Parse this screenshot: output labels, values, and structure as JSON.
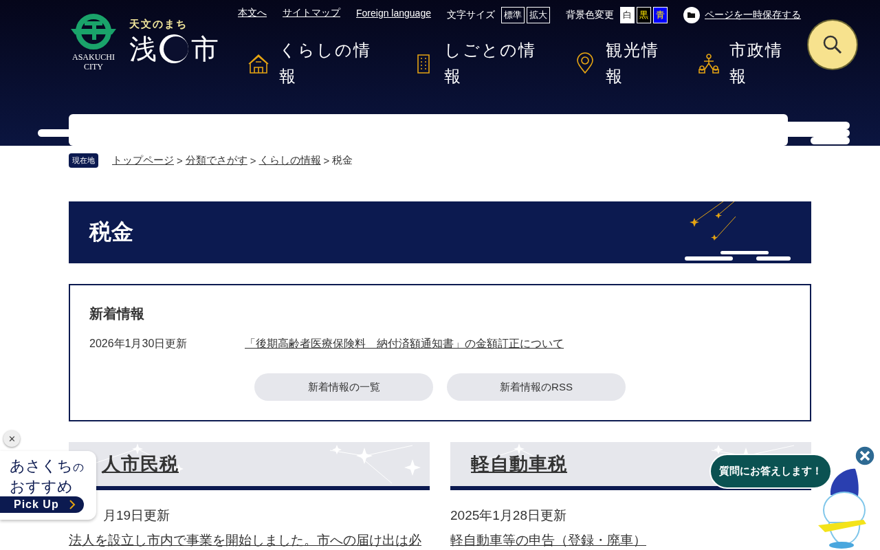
{
  "header": {
    "emblem_text": [
      "ASAKUCHI",
      "CITY"
    ],
    "tagline": "天文のまち",
    "logo_left": "浅",
    "logo_right": "市",
    "utility_links": [
      "本文へ",
      "サイトマップ",
      "Foreign language"
    ],
    "font_size": {
      "label": "文字サイズ",
      "options": [
        "標準",
        "拡大"
      ]
    },
    "bg_color": {
      "label": "背景色変更",
      "options": [
        {
          "label": "白",
          "color": "#ffffff"
        },
        {
          "label": "黒",
          "color": "#000000"
        },
        {
          "label": "青",
          "color": "#0000ff"
        }
      ]
    },
    "save_page": "ページを一時保存する",
    "nav": [
      {
        "label": "くらしの情報",
        "kind": "house"
      },
      {
        "label": "しごとの情報",
        "kind": "building"
      },
      {
        "label": "観光情報",
        "kind": "pin"
      },
      {
        "label": "市政情報",
        "kind": "people"
      }
    ]
  },
  "breadcrumb": {
    "badge": "現在地",
    "separator": ">",
    "items": [
      {
        "label": "トップページ",
        "link": true
      },
      {
        "label": "分類でさがす",
        "link": true
      },
      {
        "label": "くらしの情報",
        "link": true
      },
      {
        "label": "税金",
        "link": false
      }
    ]
  },
  "page_title": "税金",
  "news": {
    "title": "新着情報",
    "items": [
      {
        "date": "2026年1月30日更新",
        "title": "「後期高齢者医療保険料　納付済額通知書」の金額訂正について"
      }
    ],
    "buttons": [
      "新着情報の一覧",
      "新着情報のRSS"
    ]
  },
  "cards": [
    {
      "title": "人市民税",
      "date": "月19日更新",
      "link": "法人を設立し市内で事業を開始しました。市への届け出は必"
    },
    {
      "title": "軽自動車税",
      "date": "2025年1月28日更新",
      "link": "軽自動車等の申告（登録・廃車）"
    }
  ],
  "pickup": {
    "close": "✕",
    "title_main": "あさくち",
    "title_small": "の",
    "title_line2": "おすすめ",
    "button": "Pick Up"
  },
  "chat": {
    "bubble": "質問にお答えします！"
  }
}
